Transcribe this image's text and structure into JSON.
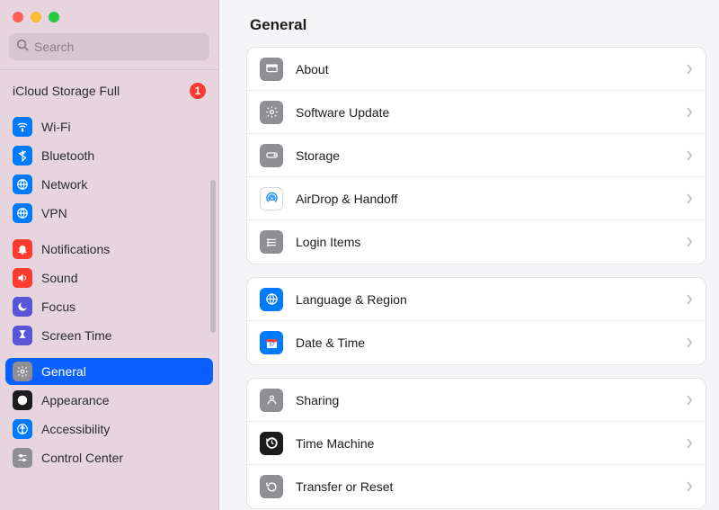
{
  "window": {
    "title": "General"
  },
  "search": {
    "placeholder": "Search"
  },
  "icloud_status": {
    "label": "iCloud Storage Full",
    "badge": "1"
  },
  "sidebar": [
    {
      "id": "wifi",
      "label": "Wi-Fi",
      "bg": "#007aff",
      "active": false
    },
    {
      "id": "bluetooth",
      "label": "Bluetooth",
      "bg": "#007aff",
      "active": false
    },
    {
      "id": "network",
      "label": "Network",
      "bg": "#007aff",
      "active": false
    },
    {
      "id": "vpn",
      "label": "VPN",
      "bg": "#007aff",
      "active": false
    },
    {
      "_gap": true
    },
    {
      "id": "notifications",
      "label": "Notifications",
      "bg": "#ff3b30",
      "active": false
    },
    {
      "id": "sound",
      "label": "Sound",
      "bg": "#ff3b30",
      "active": false
    },
    {
      "id": "focus",
      "label": "Focus",
      "bg": "#5856d6",
      "active": false
    },
    {
      "id": "screentime",
      "label": "Screen Time",
      "bg": "#5856d6",
      "active": false
    },
    {
      "_gap": true
    },
    {
      "id": "general",
      "label": "General",
      "bg": "#8e8e93",
      "active": true
    },
    {
      "id": "appearance",
      "label": "Appearance",
      "bg": "#1c1c1e",
      "active": false
    },
    {
      "id": "accessibility",
      "label": "Accessibility",
      "bg": "#007aff",
      "active": false
    },
    {
      "id": "controlcenter",
      "label": "Control Center",
      "bg": "#8e8e93",
      "active": false
    }
  ],
  "groups": [
    [
      {
        "id": "about",
        "label": "About",
        "bg": "#8e8e93"
      },
      {
        "id": "softwareupdate",
        "label": "Software Update",
        "bg": "#8e8e93"
      },
      {
        "id": "storage",
        "label": "Storage",
        "bg": "#8e8e93"
      },
      {
        "id": "airdrop",
        "label": "AirDrop & Handoff",
        "bg": "#ffffff",
        "bordered": true
      },
      {
        "id": "loginitems",
        "label": "Login Items",
        "bg": "#8e8e93"
      }
    ],
    [
      {
        "id": "language",
        "label": "Language & Region",
        "bg": "#007aff"
      },
      {
        "id": "datetime",
        "label": "Date & Time",
        "bg": "#007aff"
      }
    ],
    [
      {
        "id": "sharing",
        "label": "Sharing",
        "bg": "#8e8e93"
      },
      {
        "id": "timemachine",
        "label": "Time Machine",
        "bg": "#1c1c1e"
      },
      {
        "id": "transferreset",
        "label": "Transfer or Reset",
        "bg": "#8e8e93"
      }
    ]
  ]
}
